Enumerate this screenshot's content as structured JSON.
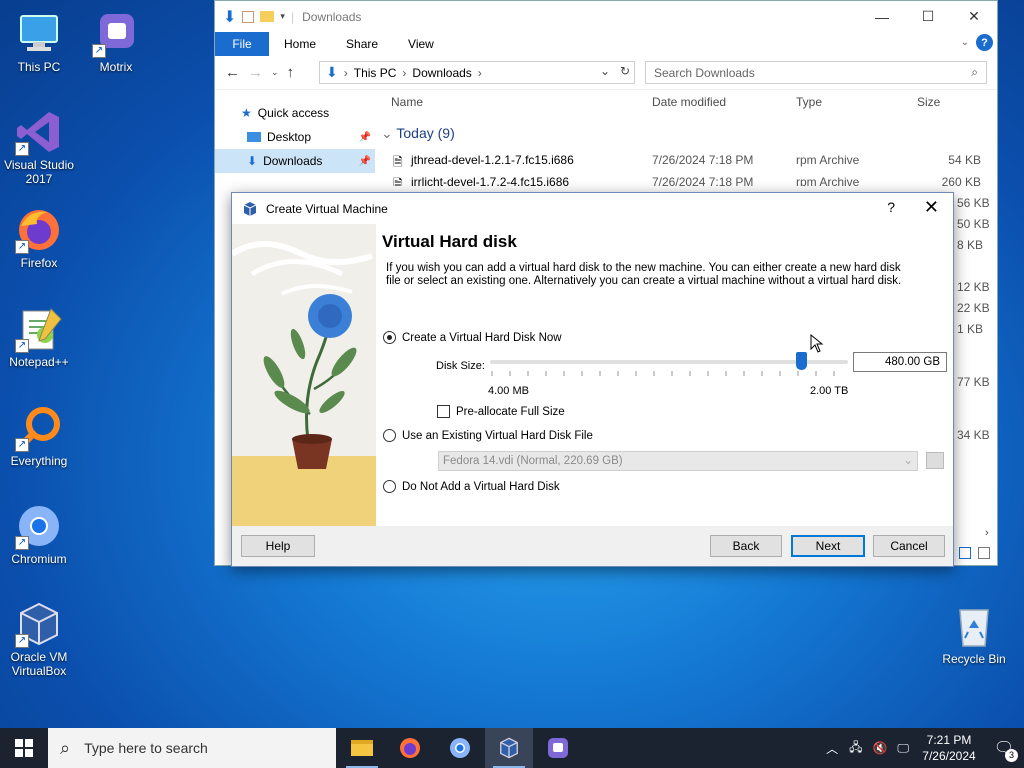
{
  "desktop": {
    "icons": [
      {
        "label": "This PC"
      },
      {
        "label": "Motrix"
      },
      {
        "label": "Visual Studio 2017"
      },
      {
        "label": "Firefox"
      },
      {
        "label": "Notepad++"
      },
      {
        "label": "Everything"
      },
      {
        "label": "Chromium"
      },
      {
        "label": "Oracle VM VirtualBox"
      },
      {
        "label": "Recycle Bin"
      }
    ]
  },
  "explorer": {
    "title": "Downloads",
    "ribbon_tabs": [
      "File",
      "Home",
      "Share",
      "View"
    ],
    "breadcrumb": [
      "This PC",
      "Downloads"
    ],
    "search_placeholder": "Search Downloads",
    "nav": {
      "quick_access": "Quick access",
      "desktop": "Desktop",
      "downloads": "Downloads"
    },
    "columns": {
      "name": "Name",
      "date": "Date modified",
      "type": "Type",
      "size": "Size"
    },
    "group": "Today (9)",
    "files": [
      {
        "name": "jthread-devel-1.2.1-7.fc15.i686",
        "date": "7/26/2024 7:18 PM",
        "type": "rpm Archive",
        "size": "54 KB"
      },
      {
        "name": "irrlicht-devel-1.7.2-4.fc15.i686",
        "date": "7/26/2024 7:18 PM",
        "type": "rpm Archive",
        "size": "260 KB"
      }
    ],
    "partial_sizes": [
      "56 KB",
      "50 KB",
      "8 KB",
      "12 KB",
      "22 KB",
      "1 KB",
      "77 KB",
      "34 KB"
    ]
  },
  "dialog": {
    "title": "Create Virtual Machine",
    "help_char": "?",
    "heading": "Virtual Hard disk",
    "description": "If you wish you can add a virtual hard disk to the new machine. You can either create a new hard disk file or select an existing one. Alternatively you can create a virtual machine without a virtual hard disk.",
    "option_create": "Create a Virtual Hard Disk Now",
    "disk_size_label": "Disk Size:",
    "disk_size_value": "480.00 GB",
    "slider_min": "4.00 MB",
    "slider_max": "2.00 TB",
    "preallocate": "Pre-allocate Full Size",
    "option_existing": "Use an Existing Virtual Hard Disk File",
    "existing_file": "Fedora 14.vdi (Normal, 220.69 GB)",
    "option_none": "Do Not Add a Virtual Hard Disk",
    "buttons": {
      "help": "Help",
      "back": "Back",
      "next": "Next",
      "cancel": "Cancel"
    }
  },
  "taskbar": {
    "search_placeholder": "Type here to search",
    "time": "7:21 PM",
    "date": "7/26/2024",
    "notification_count": "3"
  }
}
